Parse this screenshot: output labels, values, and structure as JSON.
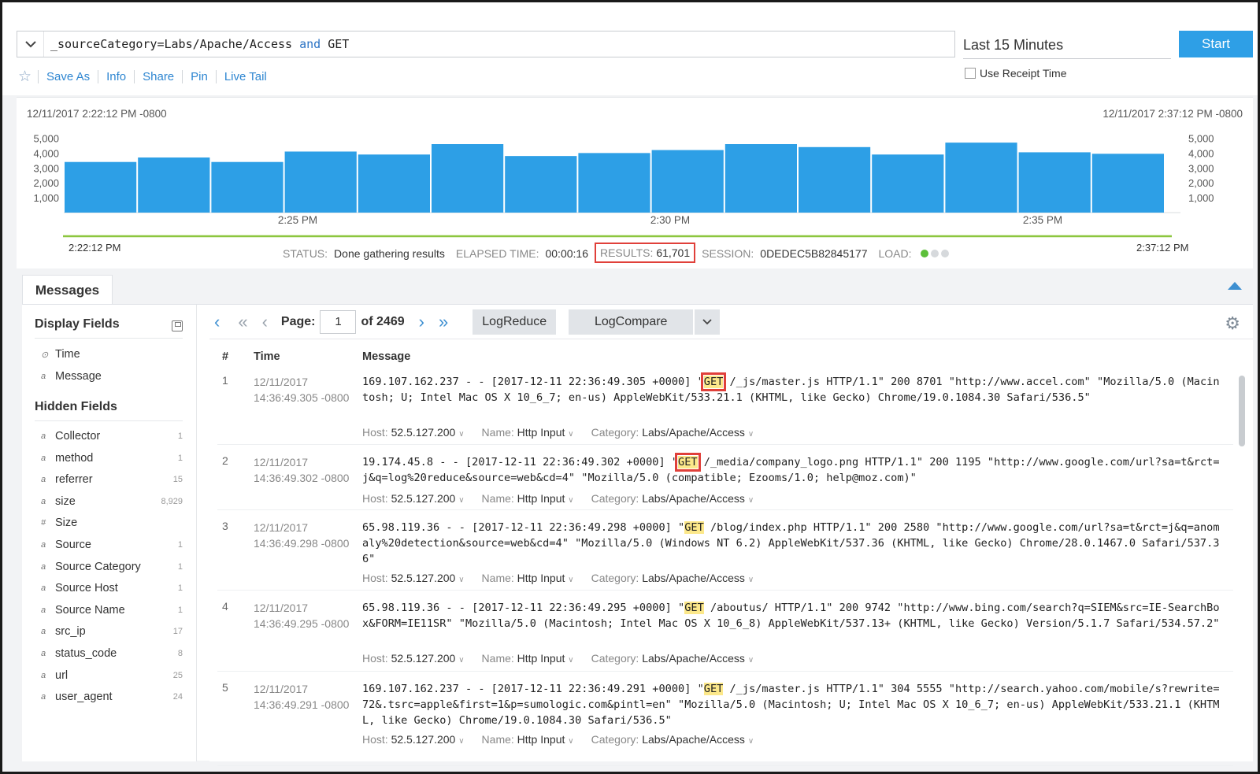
{
  "query": {
    "prefix": "_sourceCategory=Labs/Apache/Access",
    "keyword": "and",
    "suffix": "GET"
  },
  "time_range": "Last 15 Minutes",
  "start_label": "Start",
  "actions": [
    "Save As",
    "Info",
    "Share",
    "Pin",
    "Live Tail"
  ],
  "receipt_label": "Use Receipt Time",
  "histogram": {
    "start_ts": "12/11/2017 2:22:12 PM -0800",
    "end_ts": "12/11/2017 2:37:12 PM -0800",
    "y_ticks": [
      "5,000",
      "4,000",
      "3,000",
      "2,000",
      "1,000"
    ],
    "x_ticks": [
      "2:25 PM",
      "2:30 PM",
      "2:35 PM"
    ],
    "start_time": "2:22:12 PM",
    "end_time": "2:37:12 PM",
    "colors": {
      "bar": "#2d9fe6",
      "progress": "#8cc63f"
    }
  },
  "chart_data": {
    "type": "bar",
    "values": [
      3400,
      3700,
      3400,
      4100,
      3900,
      4600,
      3800,
      4000,
      4200,
      4600,
      4400,
      3900,
      4700,
      4050,
      3950
    ],
    "ylim": [
      0,
      5500
    ],
    "ticks": [
      1000,
      2000,
      3000,
      4000,
      5000
    ],
    "grid": false
  },
  "status": {
    "status_label": "STATUS:",
    "status_value": "Done gathering results",
    "elapsed_label": "ELAPSED TIME:",
    "elapsed_value": "00:00:16",
    "results_label": "RESULTS:",
    "results_value": "61,701",
    "session_label": "SESSION:",
    "session_value": "0DEDEC5B82845177",
    "load_label": "LOAD:"
  },
  "messages_tab": "Messages",
  "sidebar": {
    "display_title": "Display Fields",
    "hidden_title": "Hidden Fields",
    "display_fields": [
      {
        "type": "⊙",
        "name": "Time"
      },
      {
        "type": "a",
        "name": "Message"
      }
    ],
    "hidden_fields": [
      {
        "type": "a",
        "name": "Collector",
        "count": "1"
      },
      {
        "type": "a",
        "name": "method",
        "count": "1"
      },
      {
        "type": "a",
        "name": "referrer",
        "count": "15"
      },
      {
        "type": "a",
        "name": "size",
        "count": "8,929"
      },
      {
        "type": "#",
        "name": "Size",
        "count": ""
      },
      {
        "type": "a",
        "name": "Source",
        "count": "1"
      },
      {
        "type": "a",
        "name": "Source Category",
        "count": "1"
      },
      {
        "type": "a",
        "name": "Source Host",
        "count": "1"
      },
      {
        "type": "a",
        "name": "Source Name",
        "count": "1"
      },
      {
        "type": "a",
        "name": "src_ip",
        "count": "17"
      },
      {
        "type": "a",
        "name": "status_code",
        "count": "8"
      },
      {
        "type": "a",
        "name": "url",
        "count": "25"
      },
      {
        "type": "a",
        "name": "user_agent",
        "count": "24"
      }
    ]
  },
  "pager": {
    "page_label": "Page:",
    "page_value": "1",
    "of_label": "of 2469",
    "logreduce": "LogReduce",
    "logcompare": "LogCompare"
  },
  "columns": [
    "#",
    "Time",
    "Message"
  ],
  "rows": [
    {
      "num": "1",
      "date": "12/11/2017",
      "time": "14:36:49.305 -0800",
      "before": "169.107.162.237 - - [2017-12-11 22:36:49.305 +0000] \"",
      "get": "GET",
      "after": " /_js/master.js HTTP/1.1\" 200 8701 \"http://www.accel.com\" \"Mozilla/5.0 (Macintosh; U; Intel Mac OS X 10_6_7; en-us) AppleWebKit/533.21.1 (KHTML, like Gecko) Chrome/19.0.1084.30 Safari/536.5\"",
      "boxed": true,
      "host": "52.5.127.200",
      "name": "Http Input",
      "category": "Labs/Apache/Access"
    },
    {
      "num": "2",
      "date": "12/11/2017",
      "time": "14:36:49.302 -0800",
      "before": "19.174.45.8 - - [2017-12-11 22:36:49.302 +0000] \"",
      "get": "GET",
      "after": " /_media/company_logo.png HTTP/1.1\" 200 1195 \"http://www.google.com/url?sa=t&rct=j&q=log%20reduce&source=web&cd=4\" \"Mozilla/5.0 (compatible; Ezooms/1.0; help@moz.com)\"",
      "boxed": true,
      "host": "52.5.127.200",
      "name": "Http Input",
      "category": "Labs/Apache/Access"
    },
    {
      "num": "3",
      "date": "12/11/2017",
      "time": "14:36:49.298 -0800",
      "before": "65.98.119.36 - - [2017-12-11 22:36:49.298 +0000] \"",
      "get": "GET",
      "after": " /blog/index.php HTTP/1.1\" 200 2580 \"http://www.google.com/url?sa=t&rct=j&q=anomaly%20detection&source=web&cd=4\" \"Mozilla/5.0 (Windows NT 6.2) AppleWebKit/537.36 (KHTML, like Gecko) Chrome/28.0.1467.0 Safari/537.36\"",
      "boxed": false,
      "host": "52.5.127.200",
      "name": "Http Input",
      "category": "Labs/Apache/Access"
    },
    {
      "num": "4",
      "date": "12/11/2017",
      "time": "14:36:49.295 -0800",
      "before": "65.98.119.36 - - [2017-12-11 22:36:49.295 +0000] \"",
      "get": "GET",
      "after": " /aboutus/ HTTP/1.1\" 200 9742 \"http://www.bing.com/search?q=SIEM&src=IE-SearchBox&FORM=IE11SR\" \"Mozilla/5.0 (Macintosh; Intel Mac OS X 10_6_8) AppleWebKit/537.13+ (KHTML, like Gecko) Version/5.1.7 Safari/534.57.2\"",
      "boxed": false,
      "host": "52.5.127.200",
      "name": "Http Input",
      "category": "Labs/Apache/Access"
    },
    {
      "num": "5",
      "date": "12/11/2017",
      "time": "14:36:49.291 -0800",
      "before": "169.107.162.237 - - [2017-12-11 22:36:49.291 +0000] \"",
      "get": "GET",
      "after": " /_js/master.js HTTP/1.1\" 304 5555 \"http://search.yahoo.com/mobile/s?rewrite=72&.tsrc=apple&first=1&p=sumologic.com&pintl=en\" \"Mozilla/5.0 (Macintosh; U; Intel Mac OS X 10_6_7; en-us) AppleWebKit/533.21.1 (KHTML, like Gecko) Chrome/19.0.1084.30 Safari/536.5\"",
      "boxed": false,
      "host": "52.5.127.200",
      "name": "Http Input",
      "category": "Labs/Apache/Access"
    }
  ],
  "meta_labels": {
    "host": "Host:",
    "name": "Name:",
    "category": "Category:"
  }
}
